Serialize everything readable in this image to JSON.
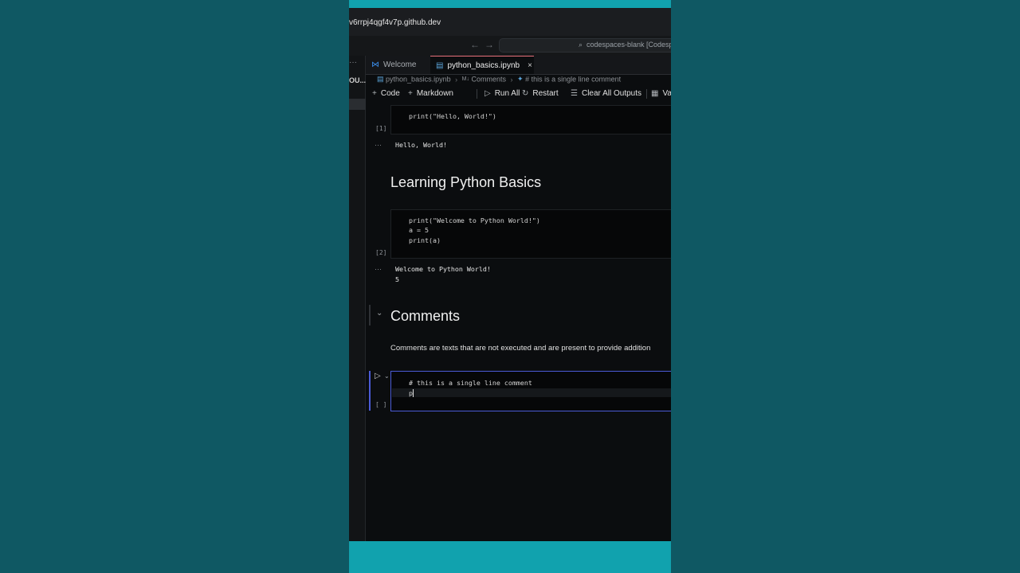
{
  "browser": {
    "url": "v6rrpj4qgf4v7p.github.dev"
  },
  "titlebar": {
    "back_icon": "←",
    "forward_icon": "→",
    "command_center_text": "codespaces-blank [Codesp"
  },
  "activity_bar": {
    "dots": "···",
    "label": "OU..."
  },
  "tabs": [
    {
      "label": "Welcome",
      "icon": "vscode-icon",
      "active": false
    },
    {
      "label": "python_basics.ipynb",
      "icon": "notebook-icon",
      "active": true,
      "close": "×"
    }
  ],
  "breadcrumb": {
    "file": "python_basics.ipynb",
    "section_prefix": "M↓",
    "section": "Comments",
    "cell": "# this is a single line comment"
  },
  "toolbar": {
    "code": "Code",
    "markdown": "Markdown",
    "run_all": "Run All",
    "restart": "Restart",
    "clear_all": "Clear All Outputs",
    "variables": "Variables"
  },
  "cells": {
    "cell1": {
      "lines": [
        "print(\"Hello, World!\")"
      ],
      "exec_count": "[1]",
      "output": [
        "Hello, World!"
      ]
    },
    "markdown1": {
      "heading": "Learning Python Basics"
    },
    "cell2": {
      "lines": [
        "print(\"Welcome to Python World!\")",
        "a = 5",
        "print(a)"
      ],
      "exec_count": "[2]",
      "output": [
        "Welcome to Python World!",
        "5"
      ]
    },
    "markdown2": {
      "heading": "Comments",
      "paragraph": "Comments are texts that are not executed and are present to provide addition"
    },
    "cell3": {
      "lines": [
        "# this is a single line comment",
        "p"
      ],
      "exec_count": "[ ]"
    }
  },
  "output_dots": "···",
  "colors": {
    "accent_teal": "#11a2ae",
    "focus_border": "#4b5bd6",
    "active_tab_top": "#e8717a"
  }
}
